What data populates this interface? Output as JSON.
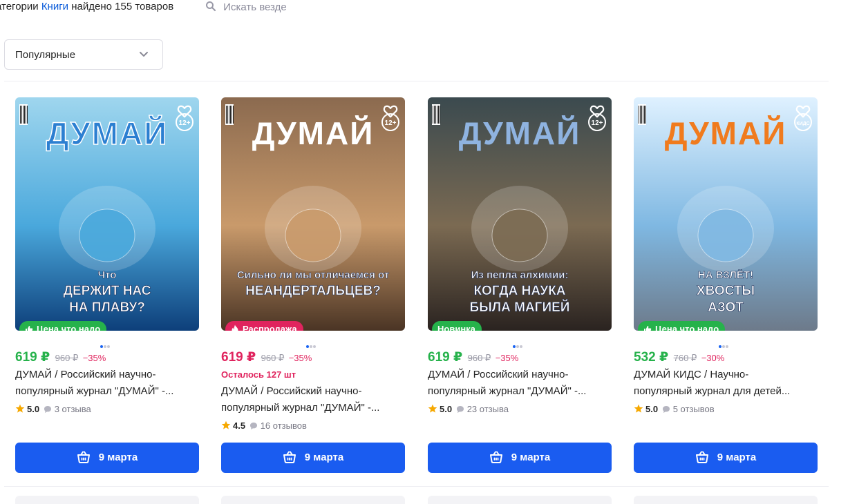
{
  "header": {
    "found_prefix": "атегории",
    "category": "Книги",
    "found_suffix": "найдено 155 товаров",
    "search_all": "Искать везде"
  },
  "sort": {
    "value": "Популярные"
  },
  "colors": {
    "accent": "#1a5cf0",
    "green": "#26b24b",
    "pink": "#e0245e"
  },
  "products": [
    {
      "badge": "Цена что надо",
      "badge_icon": "thumbs-up-icon",
      "badge_color": "#26b24b",
      "price": "619 ₽",
      "old_price": "960 ₽",
      "discount": "−35%",
      "price_color": "#26b24b",
      "stock": "",
      "title_line1": "ДУМАЙ / Российский научно-",
      "title_line2": "популярный журнал \"ДУМАЙ\" -...",
      "rating": "5.0",
      "reviews": "3 отзыва",
      "delivery": "9 марта",
      "cover": {
        "brand": "ДУМАЙ",
        "headline1": "Что",
        "headline2": "ДЕРЖИТ НАС",
        "headline3": "НА ПЛАВУ?",
        "age": "12+"
      }
    },
    {
      "badge": "Распродажа",
      "badge_icon": "fire-icon",
      "badge_color": "#e0245e",
      "price": "619 ₽",
      "old_price": "960 ₽",
      "discount": "−35%",
      "price_color": "#e0245e",
      "stock": "Осталось 127 шт",
      "title_line1": "ДУМАЙ / Российский научно-",
      "title_line2": "популярный журнал \"ДУМАЙ\" -...",
      "rating": "4.5",
      "reviews": "16 отзывов",
      "delivery": "9 марта",
      "cover": {
        "brand": "ДУМАЙ",
        "headline1": "Сильно ли мы отличаемся от",
        "headline2": "НЕАНДЕРТАЛЬЦЕВ?",
        "headline3": "",
        "age": "12+"
      }
    },
    {
      "badge": "Новинка",
      "badge_icon": "",
      "badge_color": "#26b24b",
      "price": "619 ₽",
      "old_price": "960 ₽",
      "discount": "−35%",
      "price_color": "#26b24b",
      "stock": "",
      "title_line1": "ДУМАЙ / Российский научно-",
      "title_line2": "популярный журнал \"ДУМАЙ\" -...",
      "rating": "5.0",
      "reviews": "23 отзыва",
      "delivery": "9 марта",
      "cover": {
        "brand": "ДУМАЙ",
        "headline1": "Из пепла алхимии:",
        "headline2": "КОГДА НАУКА",
        "headline3": "БЫЛА МАГИЕЙ",
        "age": "12+"
      }
    },
    {
      "badge": "Цена что надо",
      "badge_icon": "thumbs-up-icon",
      "badge_color": "#26b24b",
      "price": "532 ₽",
      "old_price": "760 ₽",
      "discount": "−30%",
      "price_color": "#26b24b",
      "stock": "",
      "title_line1": "ДУМАЙ КИДС / Научно-",
      "title_line2": "популярный журнал для детей...",
      "rating": "5.0",
      "reviews": "5 отзывов",
      "delivery": "9 марта",
      "cover": {
        "brand": "ДУМАЙ",
        "headline1": "НА ВЗЛЁТ!",
        "headline2": "ХВОСТЫ",
        "headline3": "АЗОТ",
        "age": "КИДС"
      }
    }
  ]
}
